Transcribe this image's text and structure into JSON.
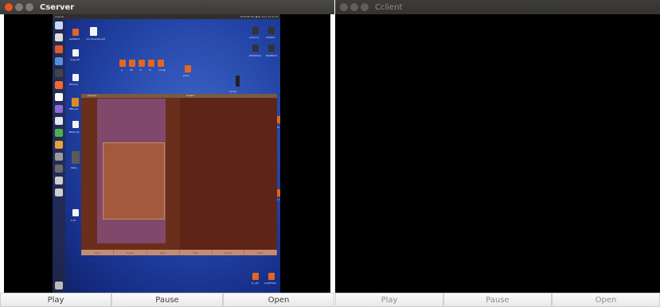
{
  "server_window": {
    "title": "Cserver",
    "controls": {
      "play": "Play",
      "pause": "Pause",
      "open": "Open"
    },
    "nested_desktop": {
      "topbar_left": "Cserver",
      "topbar_right": "ttl  PC2K  9% ◀  en  sono 11:11 Ts",
      "icons": [
        {
          "label": "apkWord"
        },
        {
          "label": "ca-rna-solve pdf"
        },
        {
          "label": "Copy bt"
        },
        {
          "label": "Bibrary"
        },
        {
          "label": "fifth.avi"
        },
        {
          "label": "BIO4 sty"
        },
        {
          "label": "SDCs"
        },
        {
          "label": "A bt"
        },
        {
          "label": "p"
        },
        {
          "label": "VP"
        },
        {
          "label": "rF"
        },
        {
          "label": "SI"
        },
        {
          "label": "yrocgl"
        },
        {
          "label": "Jvine"
        },
        {
          "label": "pole Ind"
        },
        {
          "label": "LGSGht"
        },
        {
          "label": "ROOOSile"
        },
        {
          "label": "NGSBOut"
        },
        {
          "label": "vs bta"
        },
        {
          "label": "sm bs"
        },
        {
          "label": "a f"
        },
        {
          "label": "IT_LM"
        },
        {
          "label": "loclRF050"
        }
      ],
      "nested_window": {
        "title": "Cserver",
        "client_title": "Cclient",
        "controls": {
          "play": "Play",
          "pause": "Pause",
          "open": "Open"
        }
      }
    }
  },
  "client_window": {
    "title": "Cclient",
    "controls": {
      "play": "Play",
      "pause": "Pause",
      "open": "Open"
    }
  }
}
